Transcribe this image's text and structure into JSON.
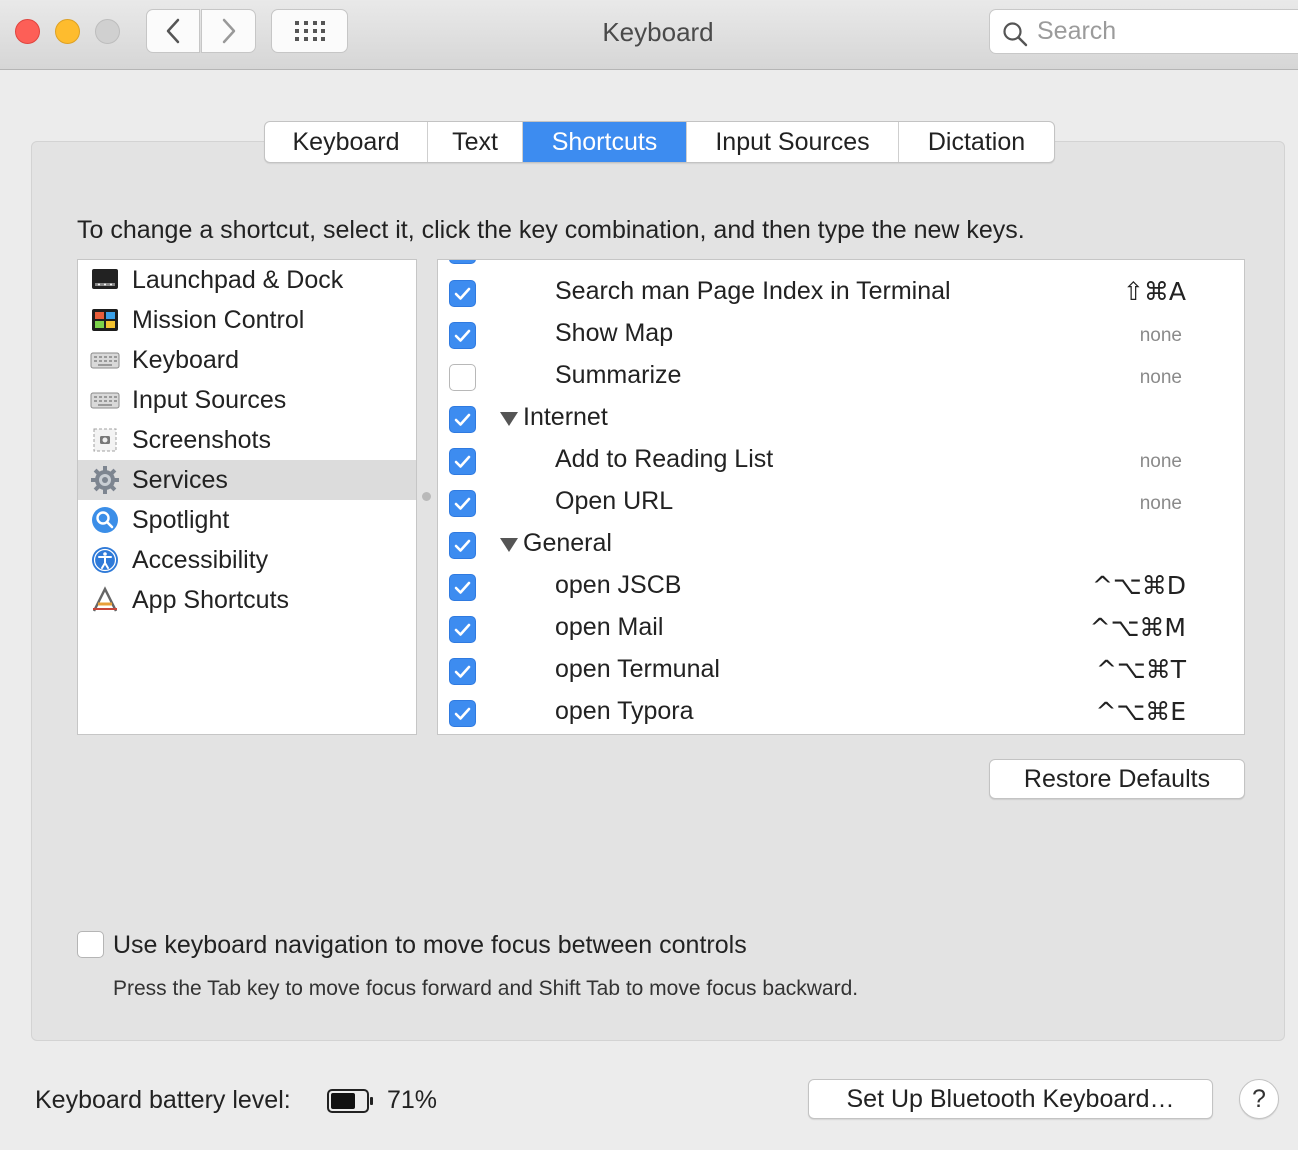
{
  "window": {
    "title": "Keyboard"
  },
  "search": {
    "placeholder": "Search"
  },
  "tabs": [
    {
      "label": "Keyboard"
    },
    {
      "label": "Text"
    },
    {
      "label": "Shortcuts",
      "active": true
    },
    {
      "label": "Input Sources"
    },
    {
      "label": "Dictation"
    }
  ],
  "instruction": "To change a shortcut, select it, click the key combination, and then type the new keys.",
  "categories": [
    {
      "label": "Launchpad & Dock",
      "icon": "launchpad-dock-icon"
    },
    {
      "label": "Mission Control",
      "icon": "mission-control-icon"
    },
    {
      "label": "Keyboard",
      "icon": "keyboard-icon"
    },
    {
      "label": "Input Sources",
      "icon": "input-sources-icon"
    },
    {
      "label": "Screenshots",
      "icon": "screenshots-icon"
    },
    {
      "label": "Services",
      "icon": "services-gear-icon",
      "selected": true
    },
    {
      "label": "Spotlight",
      "icon": "spotlight-icon"
    },
    {
      "label": "Accessibility",
      "icon": "accessibility-icon"
    },
    {
      "label": "App Shortcuts",
      "icon": "app-shortcuts-icon"
    }
  ],
  "services": [
    {
      "label": "Search man Page Index in Terminal",
      "checked": true,
      "shortcut": "⇧⌘A",
      "type": "child"
    },
    {
      "label": "Show Map",
      "checked": true,
      "shortcut": "none",
      "type": "child"
    },
    {
      "label": "Summarize",
      "checked": false,
      "shortcut": "none",
      "type": "child"
    },
    {
      "label": "Internet",
      "checked": true,
      "shortcut": "",
      "type": "group"
    },
    {
      "label": "Add to Reading List",
      "checked": true,
      "shortcut": "none",
      "type": "child"
    },
    {
      "label": "Open URL",
      "checked": true,
      "shortcut": "none",
      "type": "child"
    },
    {
      "label": "General",
      "checked": true,
      "shortcut": "",
      "type": "group"
    },
    {
      "label": "open JSCB",
      "checked": true,
      "shortcut": "^⌥⌘D",
      "type": "child"
    },
    {
      "label": "open Mail",
      "checked": true,
      "shortcut": "^⌥⌘M",
      "type": "child"
    },
    {
      "label": "open Termunal",
      "checked": true,
      "shortcut": "^⌥⌘T",
      "type": "child"
    },
    {
      "label": "open Typora",
      "checked": true,
      "shortcut": "^⌥⌘E",
      "type": "child"
    }
  ],
  "restore_defaults": "Restore Defaults",
  "keyboard_navigation": {
    "checked": false,
    "label": "Use keyboard navigation to move focus between controls",
    "hint": "Press the Tab key to move focus forward and Shift Tab to move focus backward."
  },
  "battery": {
    "label": "Keyboard battery level:",
    "percent_text": "71%",
    "level": 0.71
  },
  "bluetooth_button": "Set Up Bluetooth Keyboard…",
  "help_button": "?",
  "colors": {
    "accent": "#3d8cf0"
  }
}
